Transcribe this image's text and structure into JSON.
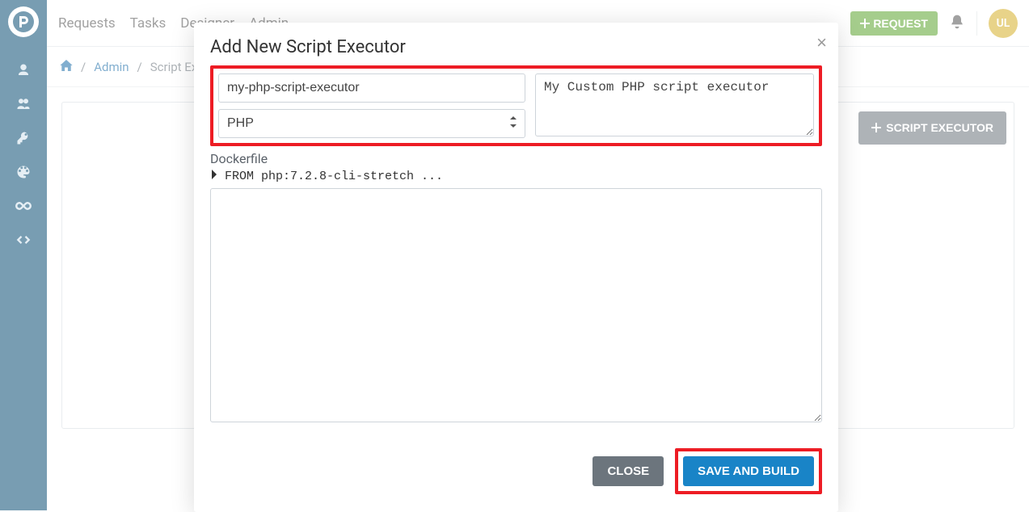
{
  "nav": {
    "items": [
      "Requests",
      "Tasks",
      "Designer",
      "Admin"
    ]
  },
  "topbar": {
    "request_btn": "REQUEST",
    "avatar_initials": "UL"
  },
  "breadcrumb": {
    "admin": "Admin",
    "current": "Script Executors"
  },
  "page": {
    "script_executor_btn": "SCRIPT EXECUTOR"
  },
  "modal": {
    "title": "Add New Script Executor",
    "name_value": "my-php-script-executor",
    "language_value": "PHP",
    "description_value": "My Custom PHP script executor",
    "dockerfile_label": "Dockerfile",
    "code_preview": "FROM php:7.2.8-cli-stretch ...",
    "close_btn": "CLOSE",
    "save_btn": "SAVE AND BUILD"
  }
}
